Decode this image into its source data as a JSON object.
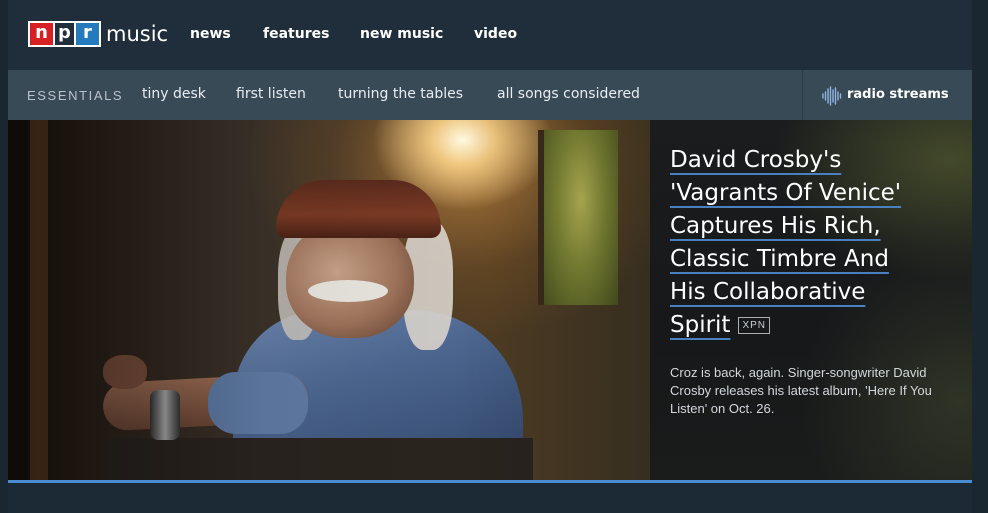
{
  "brand": {
    "npr_letters": [
      "n",
      "p",
      "r"
    ],
    "section": "music",
    "colors": {
      "n": "#d62021",
      "p": "#1f2e3a",
      "r": "#237bbd"
    }
  },
  "topnav": {
    "links": [
      "news",
      "features",
      "new music",
      "video"
    ]
  },
  "subnav": {
    "heading": "ESSENTIALS",
    "links": [
      "tiny desk",
      "first listen",
      "turning the tables",
      "all songs considered"
    ],
    "radio_label": "radio streams",
    "radio_icon": "waveform-icon"
  },
  "hero": {
    "headline_lines": [
      "David Crosby's",
      "'Vagrants Of Venice'",
      "Captures His Rich,",
      "Classic Timbre And",
      "His Collaborative",
      "Spirit"
    ],
    "tag": "XPN",
    "teaser": "Croz is back, again. Singer-songwriter David Crosby releases his latest album, 'Here If You Listen' on Oct. 26.",
    "accent_color": "#4a7fc0"
  }
}
